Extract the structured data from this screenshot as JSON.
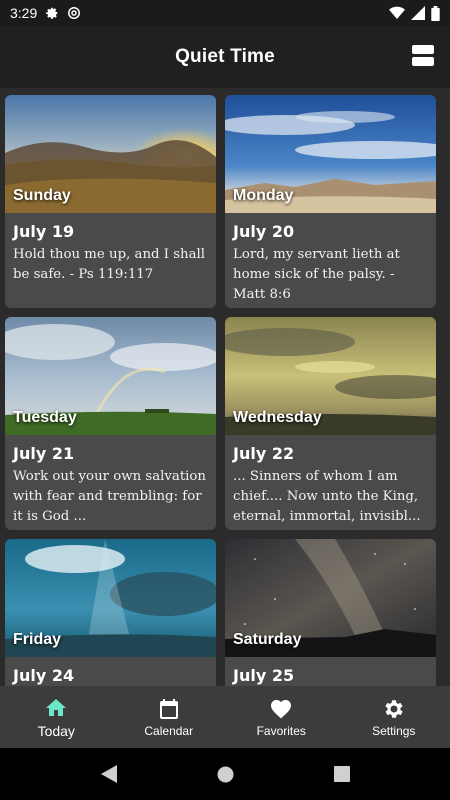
{
  "status_bar": {
    "time": "3:29",
    "icons": [
      "gear-icon",
      "at-sign-icon",
      "wifi-icon",
      "signal-icon",
      "battery-icon"
    ]
  },
  "app_bar": {
    "title": "Quiet Time",
    "view_toggle_icon": "view-toggle-icon"
  },
  "cards": [
    {
      "day": "Sunday",
      "date": "July 19",
      "verse": "Hold thou me up, and I shall be safe. - Ps 119:117",
      "image": "sunset-hills"
    },
    {
      "day": "Monday",
      "date": "July 20",
      "verse": "Lord, my servant lieth at home sick of the palsy. - Matt 8:6",
      "image": "blue-sky-clouds"
    },
    {
      "day": "Tuesday",
      "date": "July 21",
      "verse": "Work out your own salvation with fear and trembling: for it is God ...",
      "image": "rainbow-field"
    },
    {
      "day": "Wednesday",
      "date": "July 22",
      "verse": "... Sinners of whom I am chief.... Now unto the King, eternal, immortal, invisibl...",
      "image": "golden-clouds"
    },
    {
      "day": "Friday",
      "date": "July 24",
      "verse": "",
      "image": "sun-rays-sky"
    },
    {
      "day": "Saturday",
      "date": "July 25",
      "verse": "",
      "image": "milky-way"
    }
  ],
  "bottom_nav": {
    "active_color": "#6ee7c8",
    "items": [
      {
        "label": "Today",
        "icon": "home-icon",
        "active": true
      },
      {
        "label": "Calendar",
        "icon": "calendar-icon",
        "active": false
      },
      {
        "label": "Favorites",
        "icon": "heart-icon",
        "active": false
      },
      {
        "label": "Settings",
        "icon": "gear-icon",
        "active": false
      }
    ]
  },
  "system_nav": {
    "icons": [
      "back-icon",
      "home-circle-icon",
      "recents-icon"
    ]
  }
}
